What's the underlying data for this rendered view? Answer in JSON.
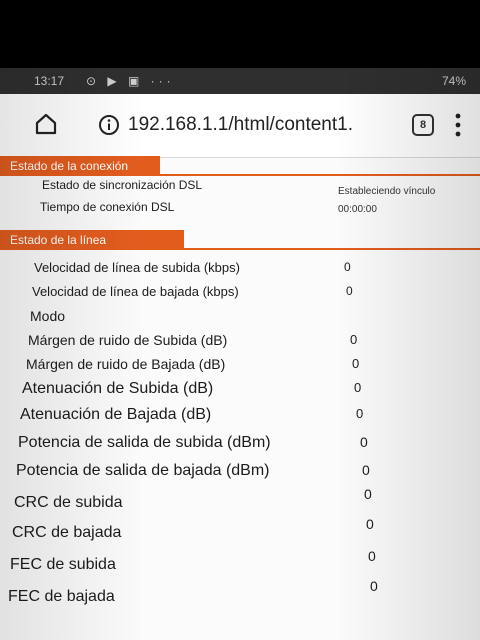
{
  "status_bar": {
    "time": "13:17",
    "icons": "⊙ ▶ ▣ ···",
    "battery": "74%"
  },
  "browser": {
    "url": "192.168.1.1/html/content1.",
    "tab_count": "8",
    "home_icon": "home-icon",
    "info_icon": "info-icon",
    "menu_icon": "more-vert-icon"
  },
  "connection_section": {
    "title": "Estado de la conexión",
    "rows": [
      {
        "label": "Estado de sincronización DSL",
        "value": "Estableciendo vínculo"
      },
      {
        "label": "Tiempo de conexión DSL",
        "value": "00:00:00"
      }
    ]
  },
  "line_section": {
    "title": "Estado de la línea",
    "rows": [
      {
        "label": "Velocidad de línea de subida (kbps)",
        "value": "0"
      },
      {
        "label": "Velocidad de línea de bajada (kbps)",
        "value": "0"
      },
      {
        "label": "Modo",
        "value": ""
      },
      {
        "label": "Márgen de ruido de Subida (dB)",
        "value": "0"
      },
      {
        "label": "Márgen de ruido de Bajada (dB)",
        "value": "0"
      },
      {
        "label": "Atenuación de Subida (dB)",
        "value": "0"
      },
      {
        "label": "Atenuación de Bajada (dB)",
        "value": "0"
      },
      {
        "label": "Potencia de salida de subida (dBm)",
        "value": "0"
      },
      {
        "label": "Potencia de salida de bajada (dBm)",
        "value": "0"
      },
      {
        "label": "CRC de subida",
        "value": "0"
      },
      {
        "label": "CRC de bajada",
        "value": "0"
      },
      {
        "label": "FEC de subida",
        "value": "0"
      },
      {
        "label": "FEC de bajada",
        "value": "0"
      }
    ]
  },
  "colors": {
    "accent": "#e25c1e",
    "status_bar": "#2f2f2f"
  }
}
